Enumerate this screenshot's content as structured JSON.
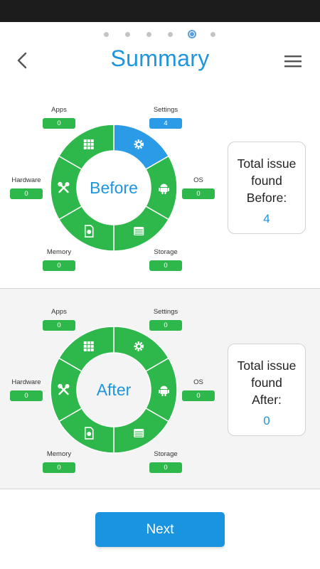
{
  "header": {
    "title": "Summary",
    "pager": {
      "count": 6,
      "active_index": 4
    }
  },
  "colors": {
    "accent": "#1e95dc",
    "ring_green": "#2eb84b",
    "highlight_blue": "#2b9be8"
  },
  "before": {
    "center_label": "Before",
    "categories": {
      "apps": {
        "label": "Apps",
        "value": "0"
      },
      "settings": {
        "label": "Settings",
        "value": "4"
      },
      "hardware": {
        "label": "Hardware",
        "value": "0"
      },
      "os": {
        "label": "OS",
        "value": "0"
      },
      "memory": {
        "label": "Memory",
        "value": "0"
      },
      "storage": {
        "label": "Storage",
        "value": "0"
      }
    },
    "highlighted_segment": "settings",
    "summary": {
      "line1": "Total issue",
      "line2": "found",
      "line3": "Before:",
      "value": "4"
    }
  },
  "after": {
    "center_label": "After",
    "categories": {
      "apps": {
        "label": "Apps",
        "value": "0"
      },
      "settings": {
        "label": "Settings",
        "value": "0"
      },
      "hardware": {
        "label": "Hardware",
        "value": "0"
      },
      "os": {
        "label": "OS",
        "value": "0"
      },
      "memory": {
        "label": "Memory",
        "value": "0"
      },
      "storage": {
        "label": "Storage",
        "value": "0"
      }
    },
    "highlighted_segment": "",
    "summary": {
      "line1": "Total issue",
      "line2": "found",
      "line3": "After:",
      "value": "0"
    }
  },
  "icons": {
    "back": "chevron-left-icon",
    "menu": "hamburger-menu-icon",
    "apps": "grid-icon",
    "settings": "gear-icon",
    "os": "android-icon",
    "storage": "storage-icon",
    "memory": "memory-card-icon",
    "hardware": "tools-icon"
  },
  "footer": {
    "next_label": "Next"
  }
}
